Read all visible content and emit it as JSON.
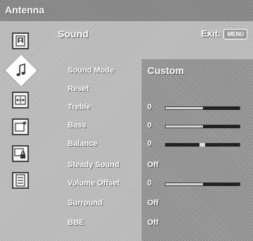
{
  "topbar": {
    "title": "Antenna"
  },
  "menu": {
    "header": "Sound",
    "exit_label": "Exit:",
    "exit_key": "MENU"
  },
  "rail_icons": [
    {
      "name": "picture-icon",
      "selected": false
    },
    {
      "name": "sound-icon",
      "selected": true
    },
    {
      "name": "screen-icon",
      "selected": false
    },
    {
      "name": "setup-icon",
      "selected": false
    },
    {
      "name": "lock-icon",
      "selected": false
    },
    {
      "name": "channel-list-icon",
      "selected": false
    }
  ],
  "settings": [
    {
      "label": "Sound Mode",
      "value": "Custom"
    },
    {
      "label": "Reset",
      "value": ""
    },
    {
      "label": "Treble",
      "value": "0",
      "slider": 0.5
    },
    {
      "label": "Bass",
      "value": "0",
      "slider": 0.5
    },
    {
      "label": "Balance",
      "value": "0",
      "slider": 0.5
    },
    {
      "label": "Steady Sound",
      "value": "Off"
    },
    {
      "label": "Volume Offset",
      "value": "0",
      "slider": 0.5
    },
    {
      "label": "Surround",
      "value": "Off"
    },
    {
      "label": "BBE",
      "value": "Off"
    }
  ]
}
